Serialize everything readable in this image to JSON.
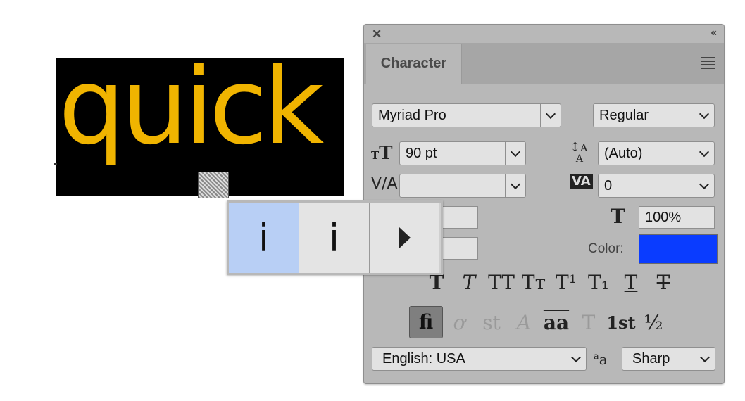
{
  "canvas": {
    "sample_word": "quick"
  },
  "panel": {
    "tab_label": "Character",
    "font_family": "Myriad Pro",
    "font_style": "Regular",
    "font_size": "90 pt",
    "leading": "(Auto)",
    "kerning": "",
    "tracking": "0",
    "vertical_scale": "100%",
    "color_label": "Color:",
    "color_value": "#0a3cff",
    "language": "English: USA",
    "antialias": "Sharp",
    "style_buttons": [
      "T",
      "T",
      "TT",
      "Tт",
      "T¹",
      "T₁",
      "T",
      "T"
    ],
    "opentype_buttons": [
      "fi",
      "ơ",
      "st",
      "A",
      "aa",
      "T",
      "1st",
      "½"
    ]
  },
  "glyph_popup": {
    "alternates": [
      "i",
      "i"
    ]
  }
}
